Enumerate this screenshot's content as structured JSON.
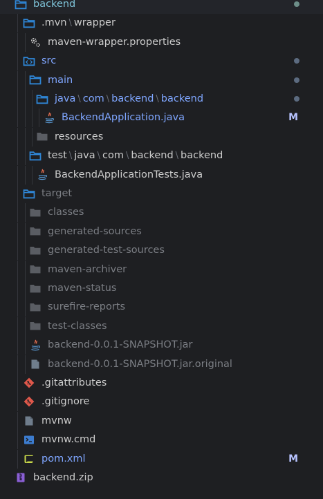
{
  "colors": {
    "background": "#1e1f22",
    "folder_open": "#2f86d6",
    "folder_closed": "#5a5d63",
    "text_default": "#cccccc",
    "text_modified": "#7fa6ff",
    "text_dimmed": "#7b7e84",
    "modified_badge": "#b7c3ff",
    "dot_gray": "#5c6b80",
    "dot_green": "#6d8f89"
  },
  "rows": [
    {
      "segments": [
        "backend"
      ],
      "icon": "folder-open-icon",
      "status": "dot-green",
      "color": "#7ec3d8"
    },
    {
      "segments": [
        ".mvn",
        "wrapper"
      ],
      "icon": "folder-open-icon",
      "color": "#cccccc"
    },
    {
      "segments": [
        "maven-wrapper.properties"
      ],
      "icon": "gear-icon",
      "color": "#cccccc"
    },
    {
      "segments": [
        "src"
      ],
      "icon": "src-folder-open-icon",
      "status": "dot-gray",
      "color": "#7fa6ff"
    },
    {
      "segments": [
        "main"
      ],
      "icon": "folder-open-icon",
      "status": "dot-gray",
      "color": "#7fa6ff"
    },
    {
      "segments": [
        "java",
        "com",
        "backend",
        "backend"
      ],
      "icon": "folder-open-icon",
      "status": "dot-gray",
      "color": "#7fa6ff"
    },
    {
      "segments": [
        "BackendApplication.java"
      ],
      "icon": "java-icon",
      "status": "M",
      "color": "#7fa6ff"
    },
    {
      "segments": [
        "resources"
      ],
      "icon": "folder-closed-icon",
      "color": "#cccccc"
    },
    {
      "segments": [
        "test",
        "java",
        "com",
        "backend",
        "backend"
      ],
      "icon": "folder-open-icon",
      "color": "#cccccc"
    },
    {
      "segments": [
        "BackendApplicationTests.java"
      ],
      "icon": "java-icon",
      "color": "#cccccc"
    },
    {
      "segments": [
        "target"
      ],
      "icon": "folder-open-icon",
      "color": "#7b7e84"
    },
    {
      "segments": [
        "classes"
      ],
      "icon": "folder-closed-icon",
      "color": "#7b7e84"
    },
    {
      "segments": [
        "generated-sources"
      ],
      "icon": "folder-closed-icon",
      "color": "#7b7e84"
    },
    {
      "segments": [
        "generated-test-sources"
      ],
      "icon": "folder-closed-icon",
      "color": "#7b7e84"
    },
    {
      "segments": [
        "maven-archiver"
      ],
      "icon": "folder-closed-icon",
      "color": "#7b7e84"
    },
    {
      "segments": [
        "maven-status"
      ],
      "icon": "folder-closed-icon",
      "color": "#7b7e84"
    },
    {
      "segments": [
        "surefire-reports"
      ],
      "icon": "folder-closed-icon",
      "color": "#7b7e84"
    },
    {
      "segments": [
        "test-classes"
      ],
      "icon": "folder-closed-icon",
      "color": "#7b7e84"
    },
    {
      "segments": [
        "backend-0.0.1-SNAPSHOT.jar"
      ],
      "icon": "java-icon",
      "color": "#7b7e84"
    },
    {
      "segments": [
        "backend-0.0.1-SNAPSHOT.jar.original"
      ],
      "icon": "file-icon",
      "color": "#7b7e84"
    },
    {
      "segments": [
        ".gitattributes"
      ],
      "icon": "git-icon",
      "color": "#cccccc"
    },
    {
      "segments": [
        ".gitignore"
      ],
      "icon": "git-icon",
      "color": "#cccccc"
    },
    {
      "segments": [
        "mvnw"
      ],
      "icon": "file-icon",
      "color": "#cccccc"
    },
    {
      "segments": [
        "mvnw.cmd"
      ],
      "icon": "terminal-icon",
      "color": "#cccccc"
    },
    {
      "segments": [
        "pom.xml"
      ],
      "icon": "xml-icon",
      "status": "M",
      "color": "#7fa6ff"
    },
    {
      "segments": [
        "backend.zip"
      ],
      "icon": "zip-icon",
      "color": "#cccccc"
    }
  ]
}
